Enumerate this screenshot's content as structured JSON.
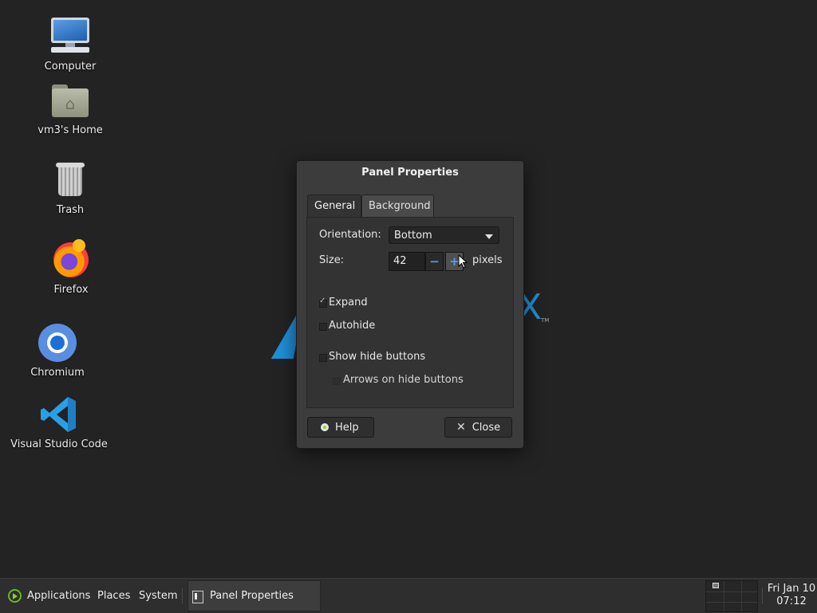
{
  "desktop": {
    "icons": [
      {
        "label": "Computer",
        "icon": "computer-icon"
      },
      {
        "label": "vm3's Home",
        "icon": "home-folder-icon"
      },
      {
        "label": "Trash",
        "icon": "trash-icon"
      },
      {
        "label": "Firefox",
        "icon": "firefox-icon"
      },
      {
        "label": "Chromium",
        "icon": "chromium-icon"
      },
      {
        "label": "Visual Studio Code",
        "icon": "vscode-icon"
      }
    ]
  },
  "dialog": {
    "title": "Panel Properties",
    "tabs": [
      {
        "label": "General",
        "active": true
      },
      {
        "label": "Background",
        "active": false
      }
    ],
    "orientation": {
      "label": "Orientation:",
      "value": "Bottom"
    },
    "size": {
      "label": "Size:",
      "value": "42",
      "unit": "pixels"
    },
    "options": [
      {
        "label": "Expand",
        "checked": true,
        "enabled": true
      },
      {
        "label": "Autohide",
        "checked": false,
        "enabled": true
      },
      {
        "label": "Show hide buttons",
        "checked": false,
        "enabled": true
      },
      {
        "label": "Arrows on hide buttons",
        "checked": false,
        "enabled": false
      }
    ],
    "buttons": {
      "help": "Help",
      "close": "Close"
    }
  },
  "panel": {
    "menus": [
      "Applications",
      "Places",
      "System"
    ],
    "task": "Panel Properties",
    "clock": {
      "day_date": "Fri Jan 10",
      "time": "07:12"
    }
  },
  "colors": {
    "desktop_bg": "#232323",
    "accent_blue": "#1e8fd6",
    "logo_green": "#8fd12e"
  }
}
